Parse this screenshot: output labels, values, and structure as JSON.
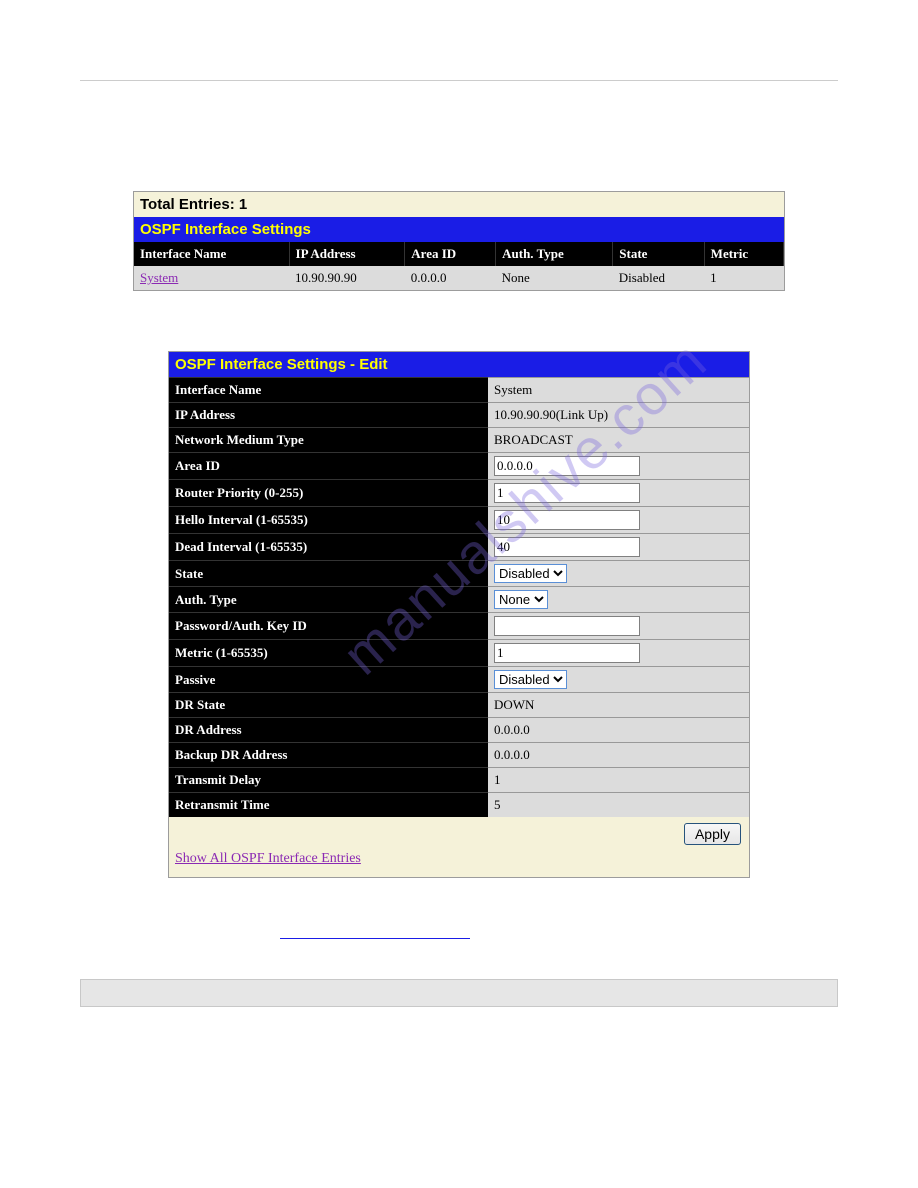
{
  "list_panel": {
    "total_entries": "Total Entries: 1",
    "title": "OSPF Interface Settings",
    "columns": {
      "interface_name": "Interface Name",
      "ip_address": "IP Address",
      "area_id": "Area ID",
      "auth_type": "Auth. Type",
      "state": "State",
      "metric": "Metric"
    },
    "row": {
      "interface_name": "System",
      "ip_address": "10.90.90.90",
      "area_id": "0.0.0.0",
      "auth_type": "None",
      "state": "Disabled",
      "metric": "1"
    }
  },
  "edit_panel": {
    "title": "OSPF Interface Settings - Edit",
    "labels": {
      "interface_name": "Interface Name",
      "ip_address": "IP Address",
      "network_medium_type": "Network Medium Type",
      "area_id": "Area ID",
      "router_priority": "Router Priority (0-255)",
      "hello_interval": "Hello Interval (1-65535)",
      "dead_interval": "Dead Interval (1-65535)",
      "state": "State",
      "auth_type": "Auth. Type",
      "password": "Password/Auth. Key ID",
      "metric": "Metric (1-65535)",
      "passive": "Passive",
      "dr_state": "DR State",
      "dr_address": "DR Address",
      "backup_dr_address": "Backup DR Address",
      "transmit_delay": "Transmit Delay",
      "retransmit_time": "Retransmit Time"
    },
    "values": {
      "interface_name": "System",
      "ip_address": "10.90.90.90(Link Up)",
      "network_medium_type": "BROADCAST",
      "area_id": "0.0.0.0",
      "router_priority": "1",
      "hello_interval": "10",
      "dead_interval": "40",
      "state": "Disabled",
      "auth_type": "None",
      "password": "",
      "metric": "1",
      "passive": "Disabled",
      "dr_state": "DOWN",
      "dr_address": "0.0.0.0",
      "backup_dr_address": "0.0.0.0",
      "transmit_delay": "1",
      "retransmit_time": "5"
    },
    "apply_label": "Apply",
    "show_all_link": "Show All OSPF Interface Entries"
  },
  "watermark": "manualshive.com"
}
